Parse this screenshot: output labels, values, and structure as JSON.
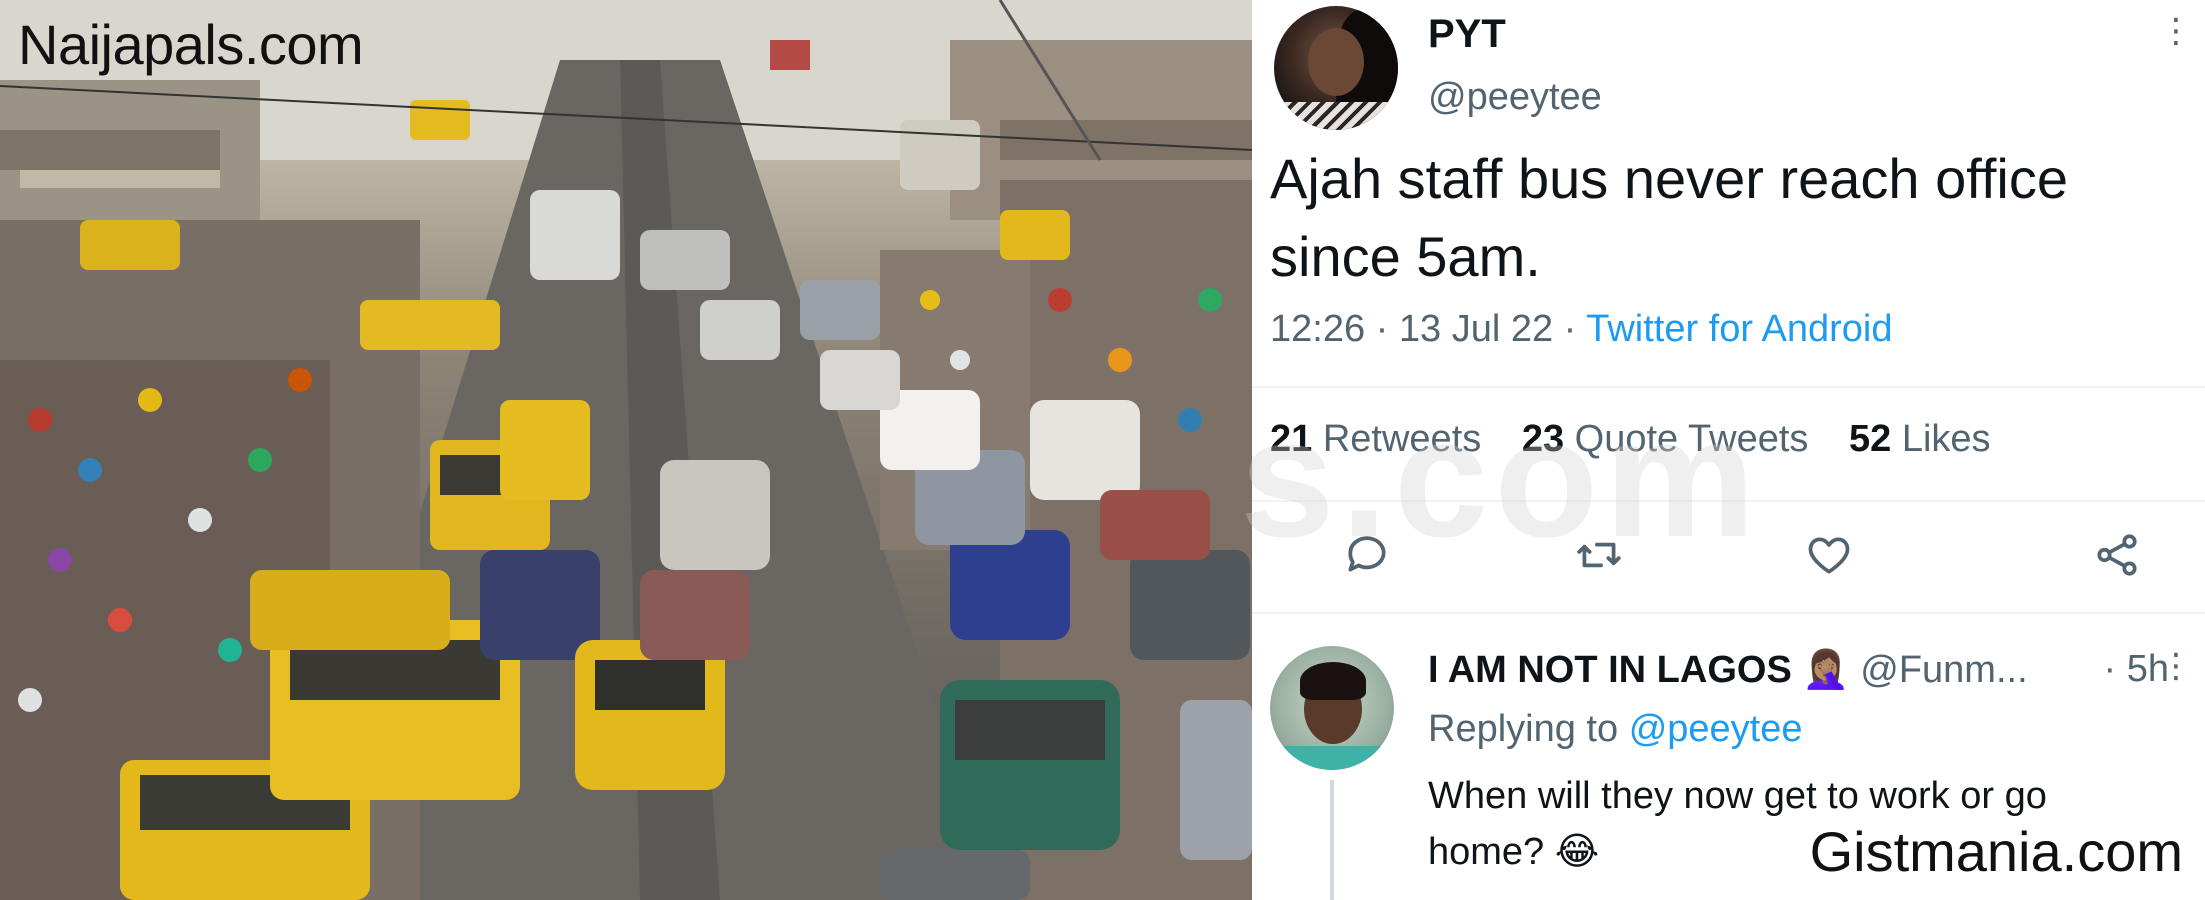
{
  "watermarks": {
    "top_left": "Naijapals.com",
    "bottom_right": "Gistmania.com",
    "center_ghost": "s.com"
  },
  "tweet": {
    "display_name": "PYT",
    "handle": "@peeytee",
    "text": "Ajah staff bus never reach office since 5am.",
    "time": "12:26",
    "date": "13 Jul 22",
    "source": "Twitter for Android",
    "stats": {
      "retweets_count": "21",
      "retweets_label": "Retweets",
      "quotes_count": "23",
      "quotes_label": "Quote Tweets",
      "likes_count": "52",
      "likes_label": "Likes"
    },
    "icons": [
      "reply-icon",
      "retweet-icon",
      "like-icon",
      "share-icon"
    ],
    "colors": {
      "link": "#1d9bf0",
      "secondary": "#536471",
      "text": "#0f1419"
    }
  },
  "reply": {
    "display_name": "I AM NOT IN LAGOS 🤦🏽‍♀️",
    "handle": "@Funm...",
    "time": "· 5h",
    "replying_prefix": "Replying to",
    "replying_to": "@peeytee",
    "text": "When will they now get to work or go home? 😂"
  }
}
